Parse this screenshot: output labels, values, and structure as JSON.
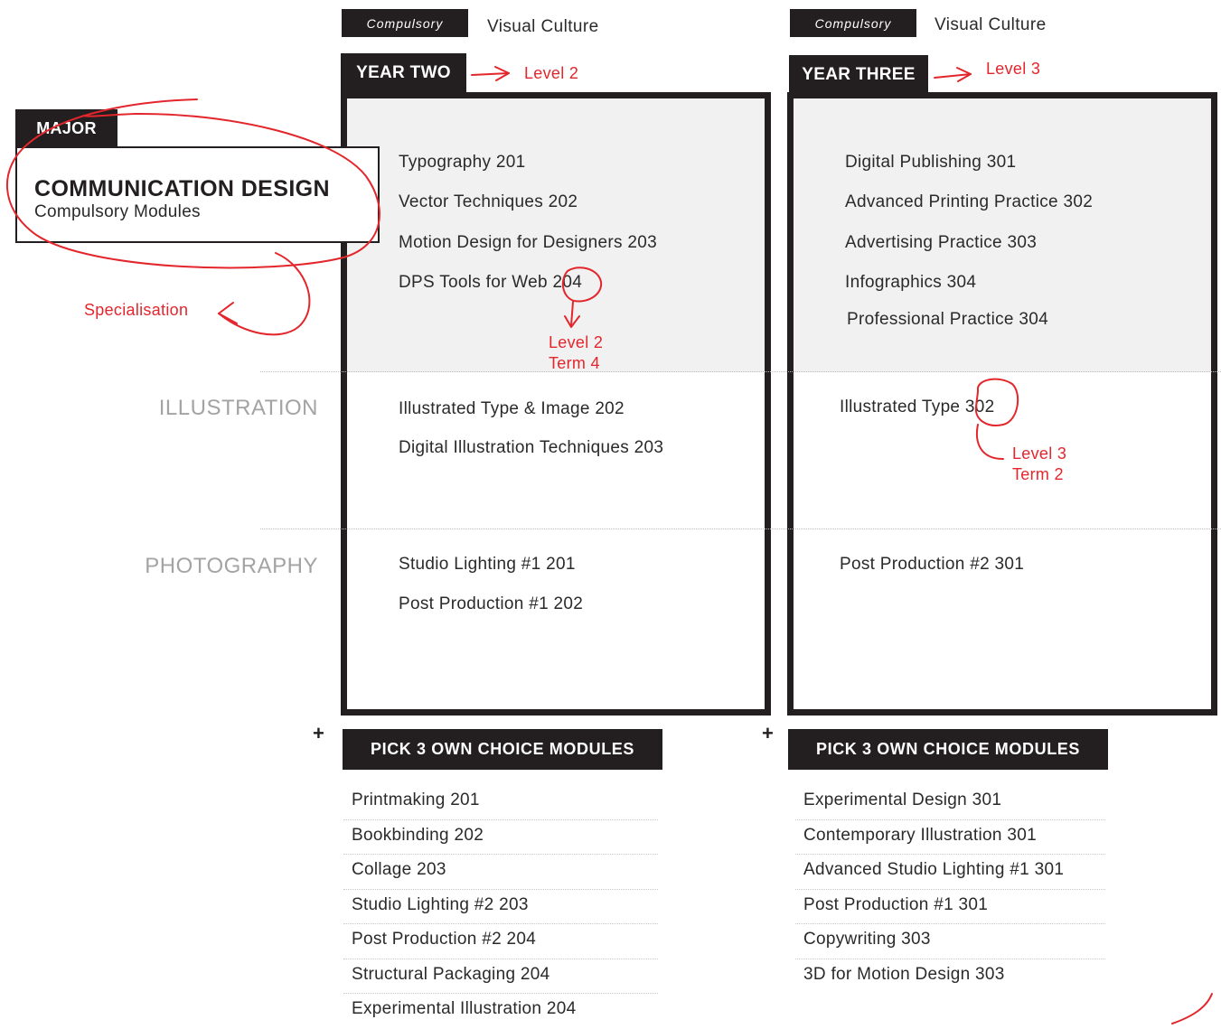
{
  "year_two": {
    "compulsory_tag": "Compulsory",
    "compulsory_module": "Visual Culture",
    "tab": "YEAR TWO",
    "core_modules": [
      "Typography 201",
      "Vector Techniques 202",
      "Motion Design for Designers 203"
    ],
    "dps_prefix": "DPS Tools for Web ",
    "dps_code": "204",
    "illustration_modules": [
      "Illustrated Type & Image 202",
      "Digital Illustration Techniques 203"
    ],
    "photography_modules": [
      "Studio Lighting #1 201",
      "Post Production #1 202"
    ],
    "plus": "+",
    "pick_label": "PICK 3 OWN CHOICE MODULES",
    "choices": [
      "Printmaking 201",
      "Bookbinding 202",
      "Collage 203",
      "Studio Lighting #2 203",
      "Post Production #2 204",
      "Structural Packaging 204",
      "Experimental Illustration 204"
    ]
  },
  "year_three": {
    "compulsory_tag": "Compulsory",
    "compulsory_module": "Visual Culture",
    "tab": "YEAR THREE",
    "core_modules": [
      "Digital Publishing 301",
      "Advanced Printing Practice 302",
      "Advertising Practice 303",
      "Infographics 304",
      "Professional Practice 304"
    ],
    "illustration_prefix": "Illustrated Type ",
    "illustration_code": "302",
    "photography_modules": [
      "Post Production #2 301"
    ],
    "plus": "+",
    "pick_label": "PICK 3 OWN CHOICE MODULES",
    "choices": [
      "Experimental Design 301",
      "Contemporary Illustration 301",
      "Advanced Studio Lighting #1 301",
      "Post Production #1 301",
      "Copywriting 303",
      "3D for Motion Design 303"
    ]
  },
  "major": {
    "tab": "MAJOR",
    "title": "COMMUNICATION DESIGN",
    "subtitle": "Compulsory Modules"
  },
  "specialisations": {
    "illustration": "ILLUSTRATION",
    "photography": "PHOTOGRAPHY"
  },
  "annotations": {
    "level2": "Level 2",
    "level3": "Level 3",
    "specialisation": "Specialisation",
    "y2_term_line1": "Level 2",
    "y2_term_line2": "Term 4",
    "y3_term_line1": "Level 3",
    "y3_term_line2": "Term 2"
  },
  "colors": {
    "dark": "#231f20",
    "annotation_red": "#e3262c",
    "shade": "#f1f1f1",
    "specialisation_grey": "#a3a3a3"
  }
}
